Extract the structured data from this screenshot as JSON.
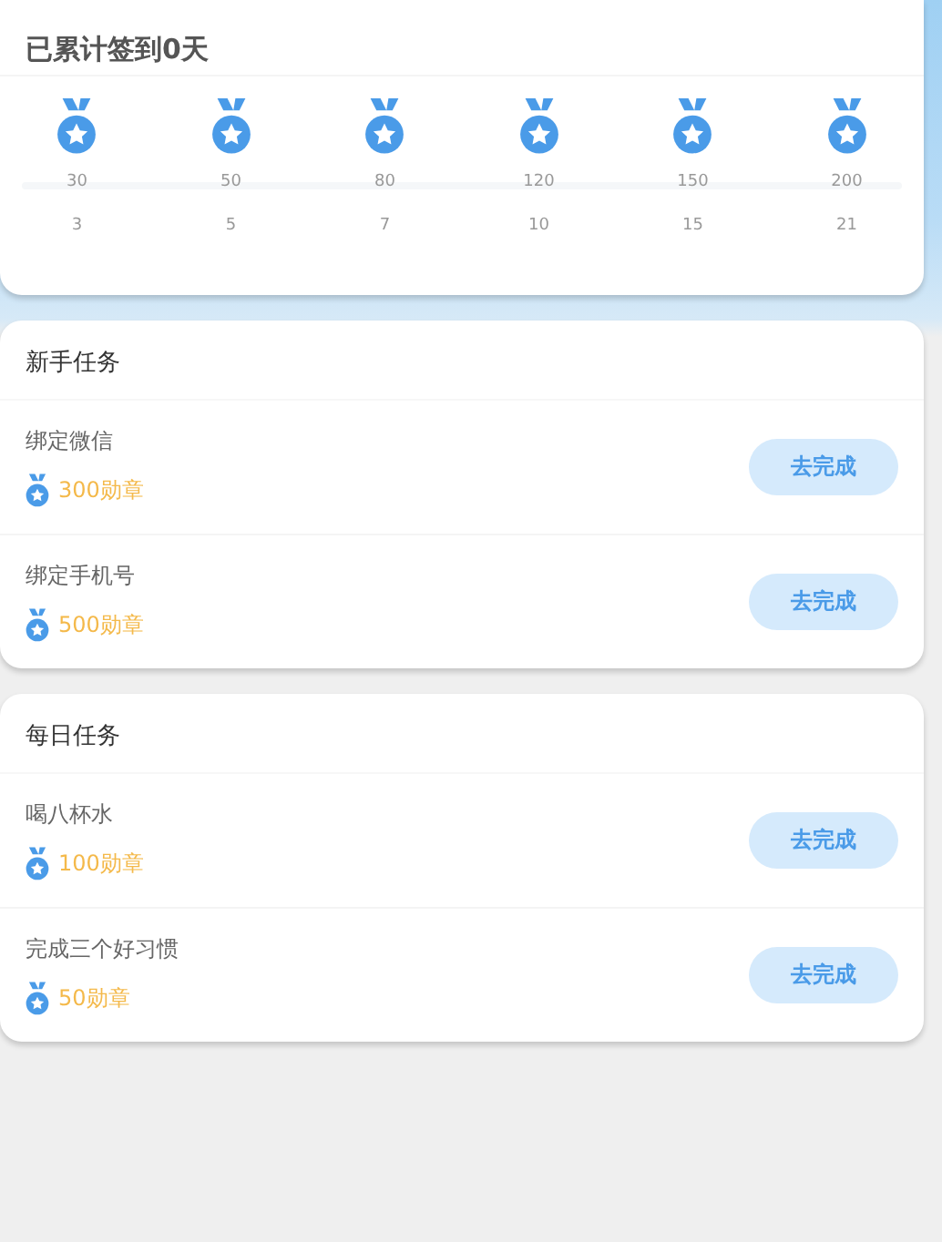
{
  "signin": {
    "title": "已累计签到0天",
    "milestones": [
      {
        "reward": "30",
        "days": "3"
      },
      {
        "reward": "50",
        "days": "5"
      },
      {
        "reward": "80",
        "days": "7"
      },
      {
        "reward": "120",
        "days": "10"
      },
      {
        "reward": "150",
        "days": "15"
      },
      {
        "reward": "200",
        "days": "21"
      }
    ]
  },
  "sections": [
    {
      "title": "新手任务",
      "tasks": [
        {
          "name": "绑定微信",
          "reward": "300勋章",
          "button": "去完成"
        },
        {
          "name": "绑定手机号",
          "reward": "500勋章",
          "button": "去完成"
        }
      ]
    },
    {
      "title": "每日任务",
      "tasks": [
        {
          "name": "喝八杯水",
          "reward": "100勋章",
          "button": "去完成"
        },
        {
          "name": "完成三个好习惯",
          "reward": "50勋章",
          "button": "去完成"
        }
      ]
    }
  ]
}
